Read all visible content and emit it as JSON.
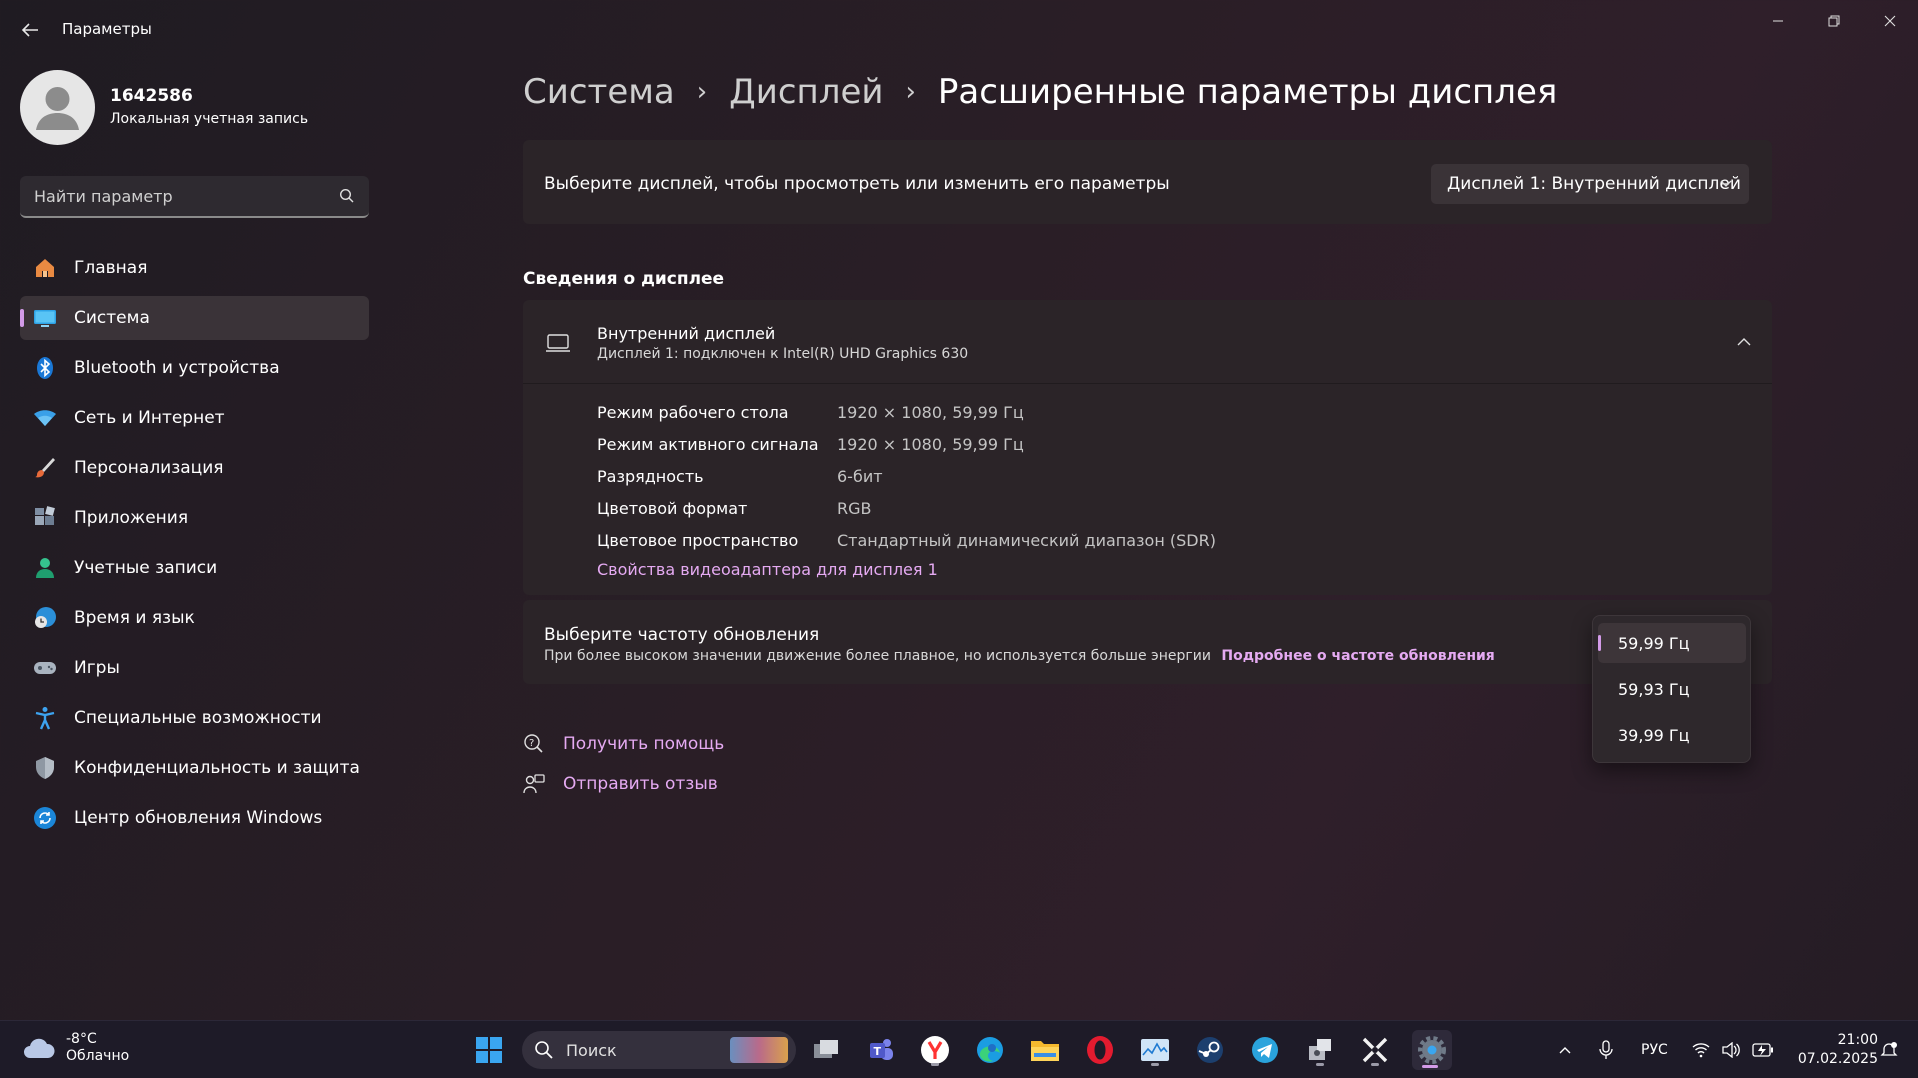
{
  "window": {
    "title": "Параметры"
  },
  "profile": {
    "name": "1642586",
    "account_type": "Локальная учетная запись"
  },
  "search": {
    "placeholder": "Найти параметр"
  },
  "sidebar": {
    "items": [
      {
        "label": "Главная",
        "icon": "home-icon",
        "active": false
      },
      {
        "label": "Система",
        "icon": "system-icon",
        "active": true
      },
      {
        "label": "Bluetooth и устройства",
        "icon": "bluetooth-icon",
        "active": false
      },
      {
        "label": "Сеть и Интернет",
        "icon": "wifi-icon",
        "active": false
      },
      {
        "label": "Персонализация",
        "icon": "brush-icon",
        "active": false
      },
      {
        "label": "Приложения",
        "icon": "apps-icon",
        "active": false
      },
      {
        "label": "Учетные записи",
        "icon": "account-icon",
        "active": false
      },
      {
        "label": "Время и язык",
        "icon": "time-language-icon",
        "active": false
      },
      {
        "label": "Игры",
        "icon": "gamepad-icon",
        "active": false
      },
      {
        "label": "Специальные возможности",
        "icon": "accessibility-icon",
        "active": false
      },
      {
        "label": "Конфиденциальность и защита",
        "icon": "shield-icon",
        "active": false
      },
      {
        "label": "Центр обновления Windows",
        "icon": "update-icon",
        "active": false
      }
    ]
  },
  "breadcrumb": {
    "items": [
      "Система",
      "Дисплей"
    ],
    "current": "Расширенные параметры дисплея"
  },
  "display_select": {
    "label": "Выберите дисплей, чтобы просмотреть или изменить его параметры",
    "value": "Дисплей 1: Внутренний дисплей"
  },
  "display_info": {
    "section_title": "Сведения о дисплее",
    "title": "Внутренний дисплей",
    "subtitle": "Дисплей 1: подключен к Intel(R) UHD Graphics 630",
    "rows": [
      {
        "key": "Режим рабочего стола",
        "value": "1920 × 1080, 59,99 Гц"
      },
      {
        "key": "Режим активного сигнала",
        "value": "1920 × 1080, 59,99 Гц"
      },
      {
        "key": "Разрядность",
        "value": "6-бит"
      },
      {
        "key": "Цветовой формат",
        "value": "RGB"
      },
      {
        "key": "Цветовое пространство",
        "value": "Стандартный динамический диапазон (SDR)"
      }
    ],
    "adapter_link": "Свойства видеоадаптера для дисплея 1"
  },
  "refresh": {
    "title": "Выберите частоту обновления",
    "description": "При более высоком значении движение более плавное, но используется больше энергии",
    "link": "Подробнее о частоте обновления",
    "options": [
      "59,99 Гц",
      "59,93 Гц",
      "39,99 Гц"
    ],
    "selected": "59,99 Гц"
  },
  "help": {
    "get_help": "Получить помощь",
    "feedback": "Отправить отзыв"
  },
  "taskbar": {
    "weather_temp": "-8°C",
    "weather_desc": "Облачно",
    "search_label": "Поиск",
    "language": "РУС",
    "time": "21:00",
    "date": "07.02.2025"
  },
  "colors": {
    "accent": "#d39be8",
    "link": "#e5aaf2",
    "card": "#2b2428"
  }
}
